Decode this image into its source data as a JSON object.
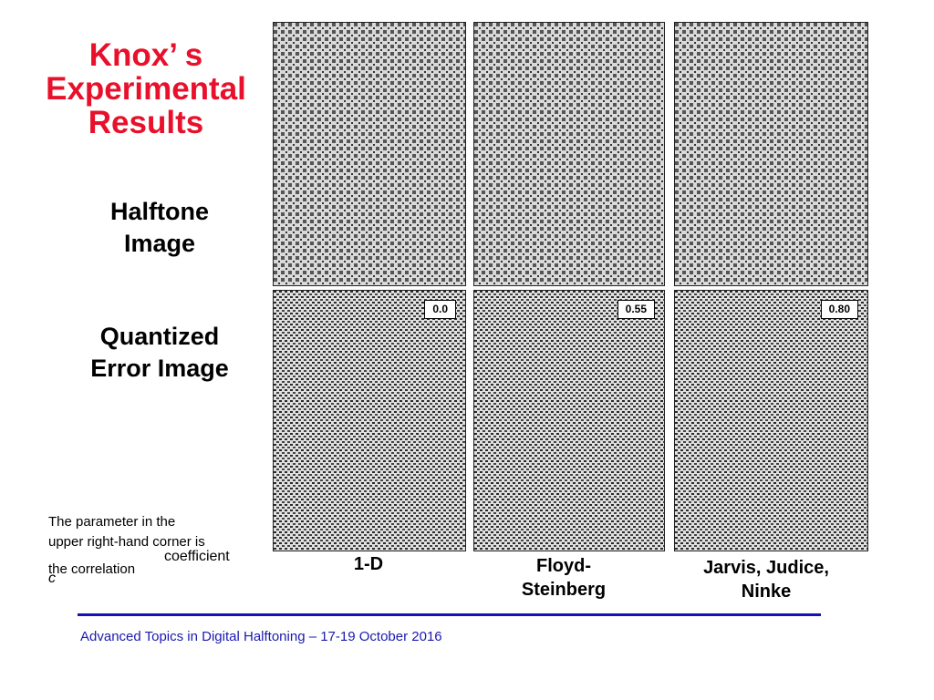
{
  "slide": {
    "title_lines": [
      "Knox’ s",
      "Experimental",
      "Results"
    ],
    "row_labels": {
      "halftone": [
        "Halftone",
        "Image"
      ],
      "quantized": [
        "Quantized",
        "Error Image"
      ]
    },
    "columns": [
      {
        "label_lines": [
          "1-D"
        ],
        "coefficient": "0.0"
      },
      {
        "label_lines": [
          "Floyd-",
          "Steinberg"
        ],
        "coefficient": "0.55"
      },
      {
        "label_lines": [
          "Jarvis, Judice,",
          "Ninke"
        ],
        "coefficient": "0.80"
      }
    ],
    "note": {
      "line1": "The parameter in the",
      "line2": "upper right-hand corner is",
      "line3": "the correlation",
      "line3_word": "coefficient",
      "variable": "c"
    },
    "footer": "Advanced Topics in Digital Halftoning – 17-19 October 2016",
    "colors": {
      "title": "#e8102a",
      "rule": "#1212b8",
      "footer": "#1a1ab0"
    }
  }
}
